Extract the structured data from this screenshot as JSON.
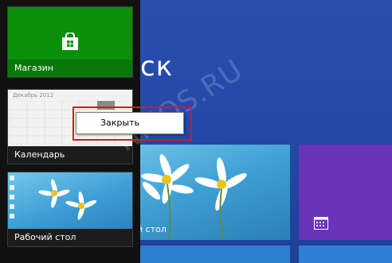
{
  "start_screen": {
    "title_fragment": "ск",
    "desktop_tile_label": "й стол"
  },
  "switcher": {
    "apps": [
      {
        "label": "Магазин",
        "icon": "store-bag-icon"
      },
      {
        "label": "Календарь",
        "month_header": "Декабрь 2012"
      },
      {
        "label": "Рабочий стол"
      }
    ]
  },
  "context_menu": {
    "items": [
      {
        "label": "Закрыть"
      }
    ]
  },
  "watermark": "NMOS.RU",
  "colors": {
    "start_bg": "#2348a6",
    "store_green": "#0a8f0a",
    "purple_tile": "#6a34b8",
    "highlight_red": "#e0141e"
  }
}
